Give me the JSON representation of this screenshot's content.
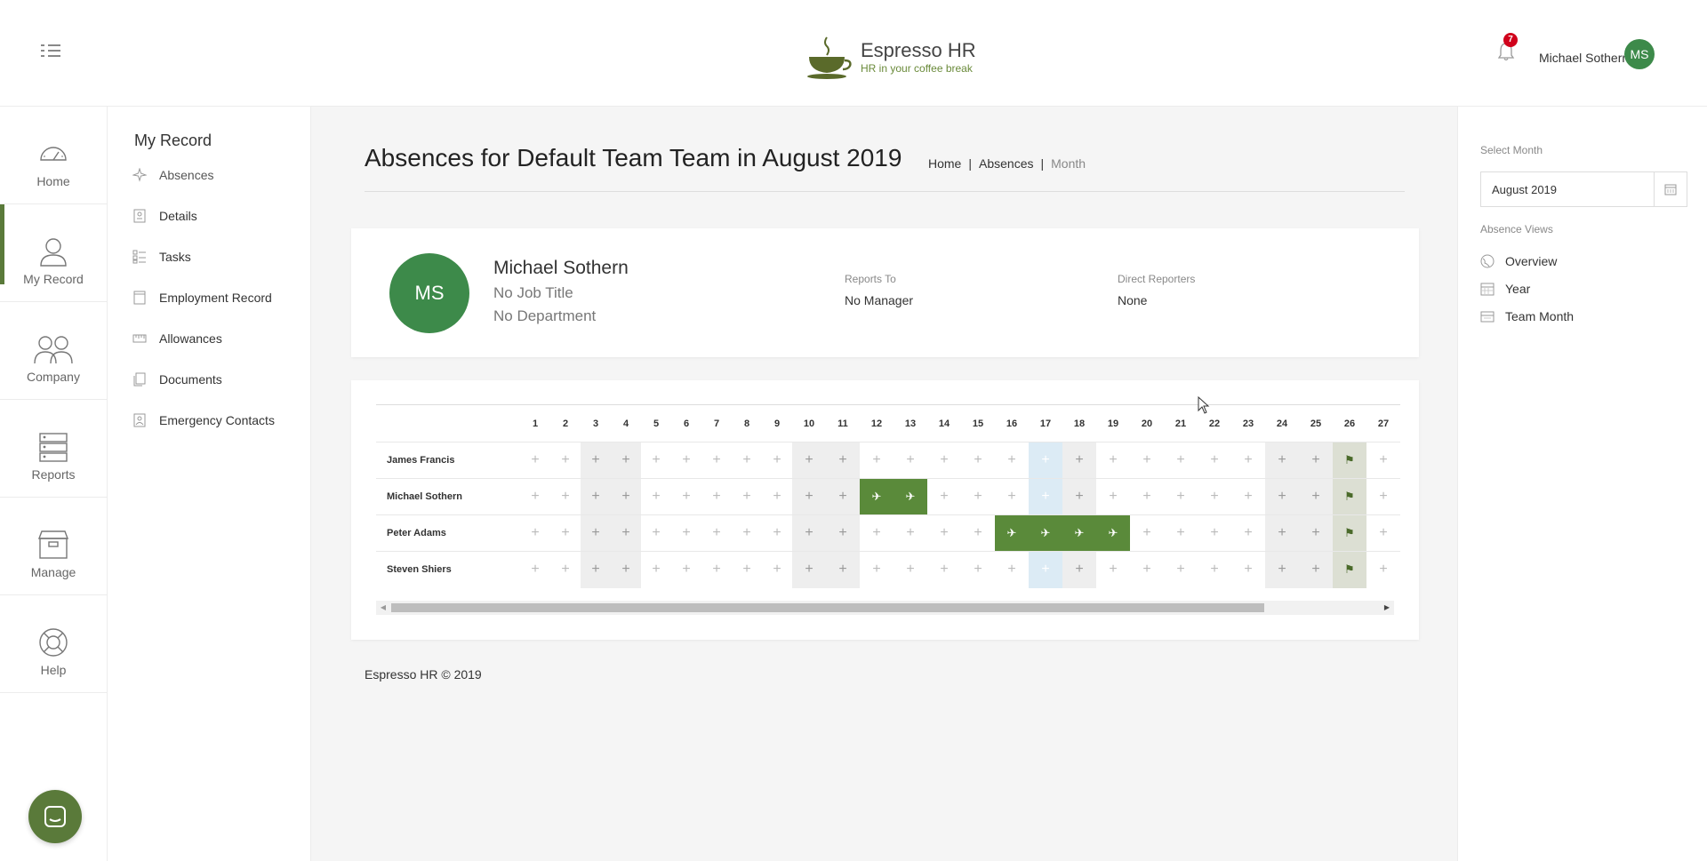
{
  "header": {
    "app_name": "Espresso HR",
    "tagline": "HR in your coffee break",
    "notification_count": "7",
    "user_name": "Michael Sothern",
    "user_initials": "MS"
  },
  "icon_nav": [
    {
      "label": "Home",
      "icon": "dashboard-icon"
    },
    {
      "label": "My Record",
      "icon": "person-icon",
      "active": true
    },
    {
      "label": "Company",
      "icon": "people-icon"
    },
    {
      "label": "Reports",
      "icon": "reports-icon"
    },
    {
      "label": "Manage",
      "icon": "box-icon"
    },
    {
      "label": "Help",
      "icon": "lifebuoy-icon"
    }
  ],
  "sub_nav": {
    "title": "My Record",
    "items": [
      {
        "label": "Absences",
        "icon": "plane-icon"
      },
      {
        "label": "Details",
        "icon": "id-card-icon"
      },
      {
        "label": "Tasks",
        "icon": "checklist-icon"
      },
      {
        "label": "Employment Record",
        "icon": "document-icon"
      },
      {
        "label": "Allowances",
        "icon": "ruler-icon"
      },
      {
        "label": "Documents",
        "icon": "copy-icon"
      },
      {
        "label": "Emergency Contacts",
        "icon": "contact-icon"
      }
    ]
  },
  "main": {
    "title": "Absences for Default Team Team in August 2019",
    "breadcrumb": [
      "Home",
      "Absences",
      "Month"
    ],
    "profile": {
      "initials": "MS",
      "name": "Michael Sothern",
      "job_title": "No Job Title",
      "department": "No Department",
      "reports_to_label": "Reports To",
      "reports_to_value": "No Manager",
      "direct_reporters_label": "Direct Reporters",
      "direct_reporters_value": "None"
    },
    "calendar": {
      "days": [
        "1",
        "2",
        "3",
        "4",
        "5",
        "6",
        "7",
        "8",
        "9",
        "10",
        "11",
        "12",
        "13",
        "14",
        "15",
        "16",
        "17",
        "18",
        "19",
        "20",
        "21",
        "22",
        "23",
        "24",
        "25",
        "26",
        "27"
      ],
      "weekend_days": [
        3,
        4,
        10,
        11,
        18,
        24,
        25
      ],
      "today_day": 17,
      "holiday_day": 26,
      "rows": [
        {
          "name": "James Francis",
          "absences": []
        },
        {
          "name": "Michael Sothern",
          "absences": [
            12,
            13
          ]
        },
        {
          "name": "Peter Adams",
          "absences": [
            16,
            17,
            18,
            19
          ]
        },
        {
          "name": "Steven Shiers",
          "absences": []
        }
      ]
    },
    "footer": "Espresso HR © 2019"
  },
  "right_panel": {
    "select_month_label": "Select Month",
    "month_value": "August 2019",
    "absence_views_label": "Absence Views",
    "views": [
      {
        "label": "Overview",
        "icon": "globe-icon"
      },
      {
        "label": "Year",
        "icon": "calendar-icon"
      },
      {
        "label": "Team Month",
        "icon": "team-calendar-icon"
      }
    ]
  },
  "colors": {
    "brand_green": "#5a8a3a",
    "avatar_green": "#3d8a4a",
    "badge_red": "#d0021b"
  }
}
